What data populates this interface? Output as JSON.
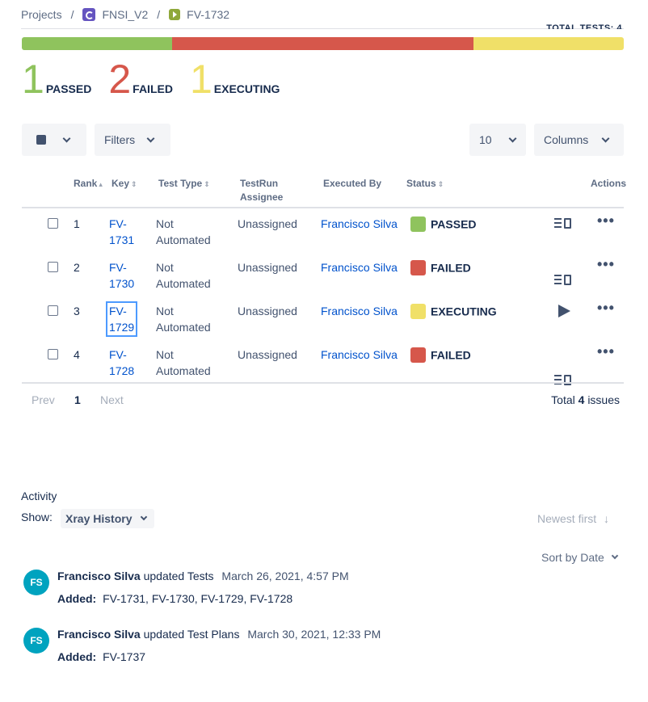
{
  "breadcrumb": {
    "projects": "Projects",
    "separator": "/",
    "project": "FNSI_V2",
    "issue": "FV-1732"
  },
  "header_cut_text": "TOTAL TESTS: 4",
  "progress": {
    "segments": [
      {
        "name": "passed",
        "fraction": 0.25,
        "color": "#8fc35d"
      },
      {
        "name": "failed",
        "fraction": 0.5,
        "color": "#d6574b"
      },
      {
        "name": "executing",
        "fraction": 0.25,
        "color": "#f0e068"
      }
    ]
  },
  "stats": {
    "passed": {
      "num": "1",
      "label": "PASSED",
      "color": "#8fc35d"
    },
    "failed": {
      "num": "2",
      "label": "FAILED",
      "color": "#d6574b"
    },
    "executing": {
      "num": "1",
      "label": "EXECUTING",
      "color": "#f0e068"
    }
  },
  "toolbar": {
    "filters_label": "Filters",
    "page_size": "10",
    "columns_label": "Columns"
  },
  "table": {
    "headers": {
      "rank": "Rank",
      "key": "Key",
      "test_type": "Test Type",
      "assignee_line1": "TestRun",
      "assignee_line2": "Assignee",
      "executed_by": "Executed By",
      "status": "Status",
      "actions": "Actions"
    },
    "rows": [
      {
        "rank": "1",
        "key1": "FV-",
        "key2": "1731",
        "type1": "Not",
        "type2": "Automated",
        "assignee": "Unassigned",
        "executed_by": "Francisco Silva",
        "status": "PASSED",
        "status_color": "#8fc35d",
        "action": "details-icon"
      },
      {
        "rank": "2",
        "key1": "FV-",
        "key2": "1730",
        "type1": "Not",
        "type2": "Automated",
        "assignee": "Unassigned",
        "executed_by": "Francisco Silva",
        "status": "FAILED",
        "status_color": "#d6574b",
        "action": "details-icon"
      },
      {
        "rank": "3",
        "key1": "FV-",
        "key2": "1729",
        "type1": "Not",
        "type2": "Automated",
        "assignee": "Unassigned",
        "executed_by": "Francisco Silva",
        "status": "EXECUTING",
        "status_color": "#f0e068",
        "action": "play-icon"
      },
      {
        "rank": "4",
        "key1": "FV-",
        "key2": "1728",
        "type1": "Not",
        "type2": "Automated",
        "assignee": "Unassigned",
        "executed_by": "Francisco Silva",
        "status": "FAILED",
        "status_color": "#d6574b",
        "action": "details-icon"
      }
    ]
  },
  "pager": {
    "prev": "Prev",
    "current": "1",
    "next": "Next",
    "total_prefix": "Total",
    "total_count": "4",
    "total_suffix": "issues"
  },
  "activity": {
    "title": "Activity",
    "show_label": "Show:",
    "filter": "Xray History",
    "order": "Newest first",
    "sort": "Sort by Date",
    "items": [
      {
        "initials": "FS",
        "user": "Francisco Silva",
        "action": "updated Tests",
        "date": "March 26, 2021, 4:57 PM",
        "added_label": "Added:",
        "added": "FV-1731, FV-1730, FV-1729, FV-1728"
      },
      {
        "initials": "FS",
        "user": "Francisco Silva",
        "action": "updated Test Plans",
        "date": "March 30, 2021, 12:33 PM",
        "added_label": "Added:",
        "added": "FV-1737"
      }
    ]
  }
}
